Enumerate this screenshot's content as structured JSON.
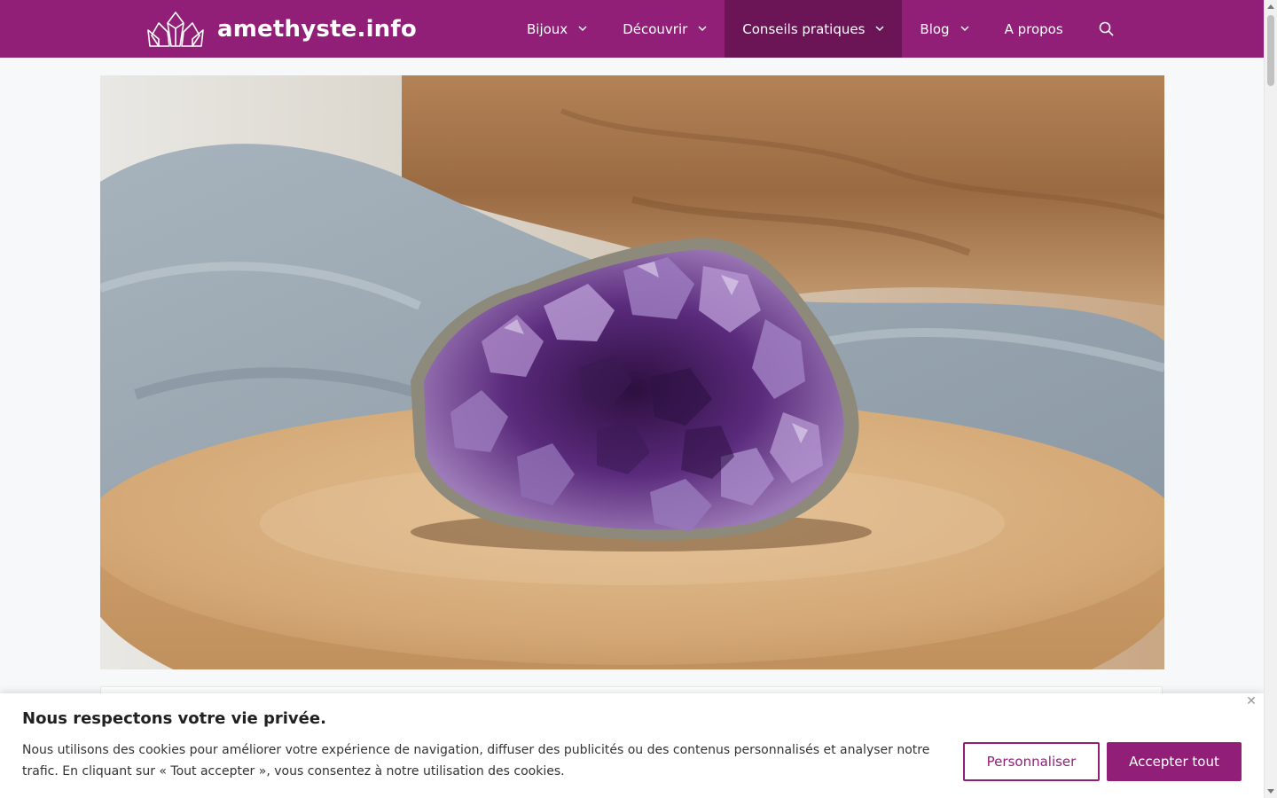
{
  "header": {
    "site_title": "amethyste.info",
    "nav": [
      {
        "label": "Bijoux",
        "has_dropdown": true,
        "active": false
      },
      {
        "label": "Découvrir",
        "has_dropdown": true,
        "active": false
      },
      {
        "label": "Conseils pratiques",
        "has_dropdown": true,
        "active": true
      },
      {
        "label": "Blog",
        "has_dropdown": true,
        "active": false
      },
      {
        "label": "A propos",
        "has_dropdown": false,
        "active": false
      }
    ],
    "search_icon": "search-icon",
    "logo_icon": "crystal-logo-icon"
  },
  "colors": {
    "brand": "#911f77",
    "brand_active": "#6b1557",
    "page_background": "#f7f8f9"
  },
  "hero": {
    "icon": "amethyst-geode-photo"
  },
  "cookie_banner": {
    "title": "Nous respectons votre vie privée.",
    "text": "Nous utilisons des cookies pour améliorer votre expérience de navigation, diffuser des publicités ou des contenus personnalisés et analyser notre trafic. En cliquant sur « Tout accepter », vous consentez à notre utilisation des cookies.",
    "customize_label": "Personnaliser",
    "accept_label": "Accepter tout",
    "close_icon": "close-icon"
  }
}
